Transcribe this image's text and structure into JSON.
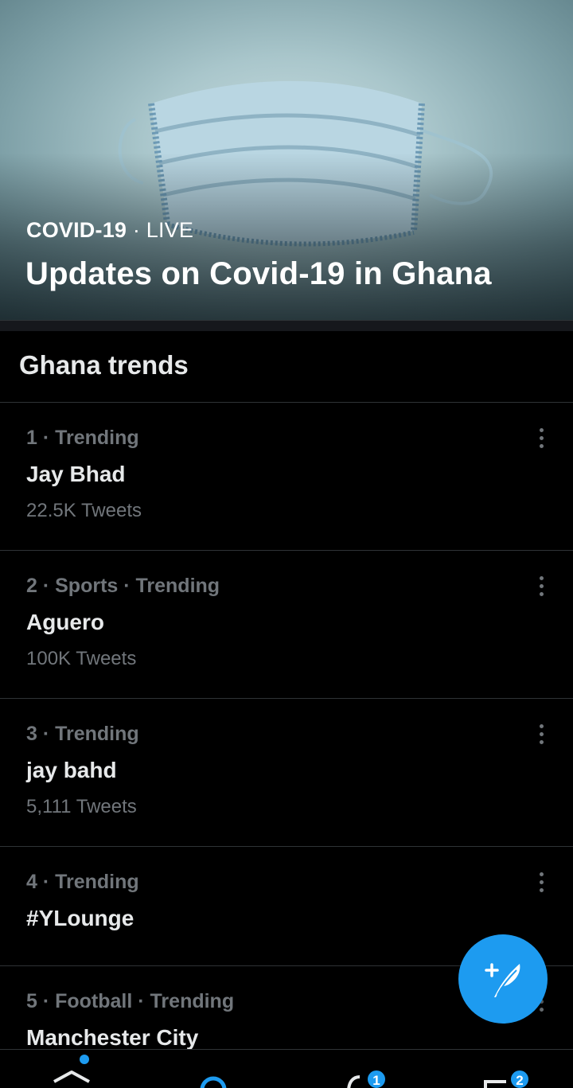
{
  "hero": {
    "category": "COVID-19",
    "separator": "·",
    "status": "LIVE",
    "title": "Updates on Covid-19 in Ghana"
  },
  "section": {
    "title": "Ghana trends"
  },
  "trends": [
    {
      "meta": "1 · Trending",
      "name": "Jay Bhad",
      "count": "22.5K Tweets"
    },
    {
      "meta": "2 · Sports · Trending",
      "name": "Aguero",
      "count": "100K Tweets"
    },
    {
      "meta": "3 · Trending",
      "name": "jay bahd",
      "count": "5,111 Tweets"
    },
    {
      "meta": "4 · Trending",
      "name": "#YLounge",
      "count": ""
    },
    {
      "meta": "5 · Football · Trending",
      "name": "Manchester City",
      "count": ""
    }
  ],
  "fab": {
    "icon": "compose-tweet-icon"
  },
  "nav": {
    "home_icon": "home-icon",
    "search_icon": "search-icon",
    "notifications_icon": "bell-icon",
    "notifications_badge": "1",
    "messages_icon": "mail-icon",
    "messages_badge": "2"
  },
  "colors": {
    "accent": "#1d9bf0",
    "background": "#000000",
    "muted": "#71767b",
    "divider": "#2f3336"
  }
}
